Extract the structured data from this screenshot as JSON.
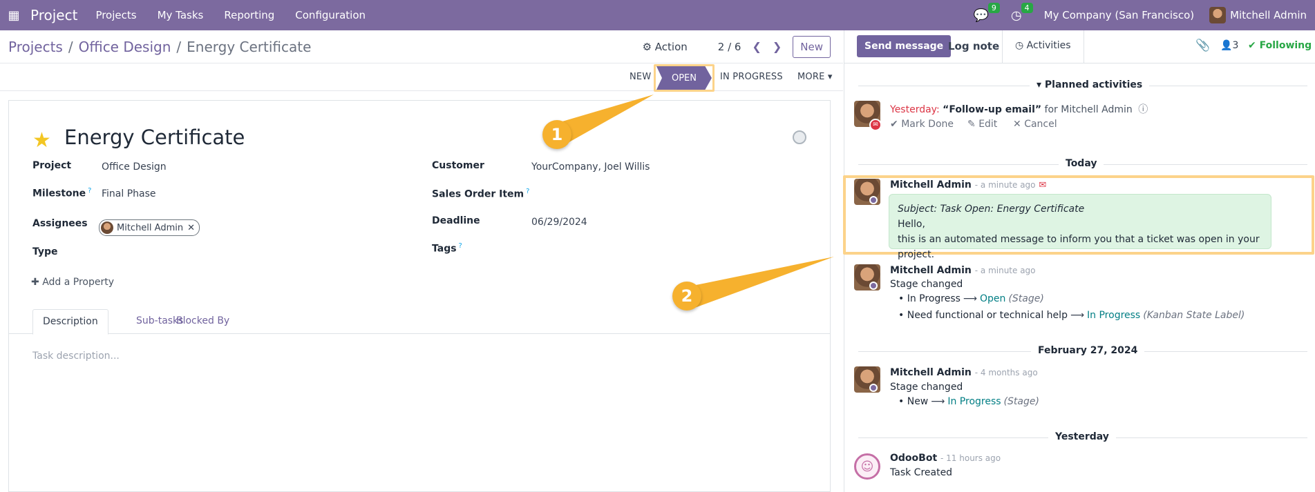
{
  "navbar": {
    "app_name": "Project",
    "menu": [
      "Projects",
      "My Tasks",
      "Reporting",
      "Configuration"
    ],
    "messages_count": "9",
    "activities_count": "4",
    "company": "My Company (San Francisco)",
    "user": "Mitchell Admin",
    "bg_color": "#7c6a9f"
  },
  "breadcrumb": {
    "projects": "Projects",
    "project": "Office Design",
    "current": "Energy Certificate"
  },
  "control": {
    "action_label": "Action",
    "pager": "2 / 6",
    "new_label": "New"
  },
  "stages": {
    "new": "NEW",
    "open": "OPEN",
    "in_progress": "IN PROGRESS",
    "more": "MORE"
  },
  "form": {
    "title": "Energy Certificate",
    "project_label": "Project",
    "project_value": "Office Design",
    "milestone_label": "Milestone",
    "milestone_value": "Final Phase",
    "assignees_label": "Assignees",
    "assignee": "Mitchell Admin",
    "type_label": "Type",
    "customer_label": "Customer",
    "customer_value": "YourCompany, Joel Willis",
    "soi_label": "Sales Order Item",
    "deadline_label": "Deadline",
    "deadline_value": "06/29/2024",
    "tags_label": "Tags",
    "add_property": "Add a Property",
    "tabs": [
      "Description",
      "Sub-tasks",
      "Blocked By"
    ],
    "description_placeholder": "Task description...",
    "help_mark": "?"
  },
  "callouts": [
    "1",
    "2"
  ],
  "chatter": {
    "send_message": "Send message",
    "log_note": "Log note",
    "activities": "Activities",
    "followers_count": "3",
    "following": "Following",
    "planned_activities": "Planned activities",
    "activity": {
      "when": "Yesterday:",
      "title": "“Follow-up email”",
      "for": "for Mitchell Admin",
      "mark_done": "Mark Done",
      "edit": "Edit",
      "cancel": "Cancel"
    },
    "sep_today": "Today",
    "sep_feb": "February 27, 2024",
    "sep_yesterday": "Yesterday",
    "messages": [
      {
        "author": "Mitchell Admin",
        "time": "- a minute ago",
        "subject": "Subject: Task Open: Energy Certificate",
        "line1": "Hello,",
        "line2": "this is an automated message to inform you that a ticket was open in your project."
      },
      {
        "author": "Mitchell Admin",
        "time": "- a minute ago",
        "text": "Stage changed",
        "b1_from": "In Progress",
        "b1_to": "Open",
        "b1_field": "(Stage)",
        "b2_from": "Need functional or technical help",
        "b2_to": "In Progress",
        "b2_field": "(Kanban State Label)"
      },
      {
        "author": "Mitchell Admin",
        "time": "- 4 months ago",
        "text": "Stage changed",
        "b1_from": "New",
        "b1_to": "In Progress",
        "b1_field": "(Stage)"
      },
      {
        "author": "OdooBot",
        "time": "- 11 hours ago",
        "text": "Task Created"
      }
    ]
  }
}
